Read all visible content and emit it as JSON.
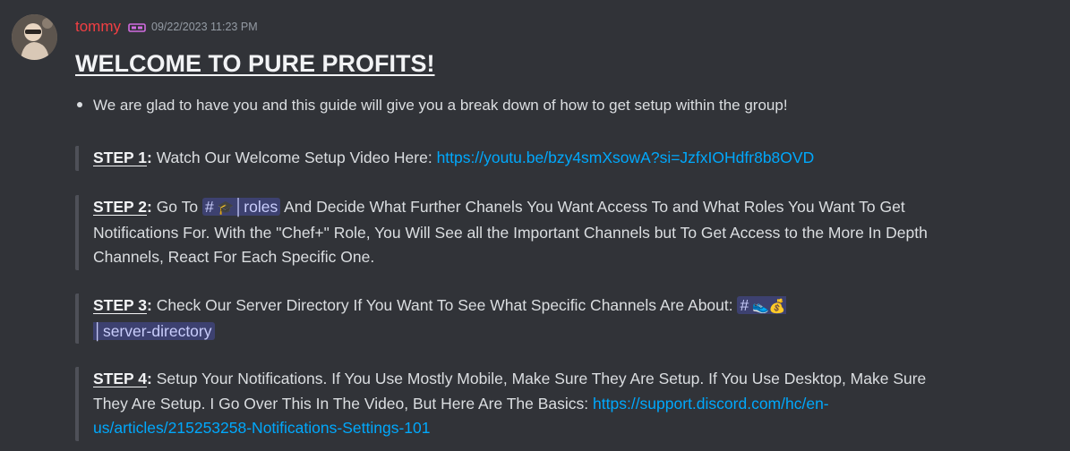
{
  "message": {
    "author": "tommy",
    "author_color": "#f23f43",
    "timestamp": "09/22/2023 11:23 PM",
    "role_icon": "ticket-icon",
    "title": "WELCOME TO PURE PROFITS!",
    "bullet": "We are glad to have you and this guide will give you a break down of how to get setup within the group!",
    "steps": [
      {
        "label": "STEP 1",
        "text": " Watch Our Welcome Setup Video Here: ",
        "link": "https://youtu.be/bzy4smXsowA?si=JzfxIOHdfr8b8OVD"
      },
      {
        "label": "STEP 2",
        "text_before": " Go To ",
        "channel_hash": "#",
        "channel_emoji": "🎓",
        "channel_name": "│roles",
        "text_after": " And Decide What Further Chanels You Want Access To and What Roles You Want To Get Notifications For. With the \"Chef+\" Role, You Will See all the Important Channels but To Get Access to the More In Depth Channels, React For Each Specific One."
      },
      {
        "label": "STEP 3",
        "text_before": " Check Our Server Directory If You Want To See What Specific Channels Are About: ",
        "channel_hash": "#",
        "channel_emoji": "👟💰",
        "channel_name": "│server-directory"
      },
      {
        "label": "STEP 4",
        "text": " Setup Your Notifications. If You Use Mostly Mobile, Make Sure They Are Setup. If You Use Desktop, Make Sure They Are Setup. I Go Over This In The Video, But Here Are The Basics: ",
        "link": "https://support.discord.com/hc/en-us/articles/215253258-Notifications-Settings-101"
      }
    ]
  },
  "colors": {
    "background": "#313338",
    "link": "#00a8fc",
    "mention_bg": "#3c4270",
    "quote_bar": "#4e5058"
  }
}
